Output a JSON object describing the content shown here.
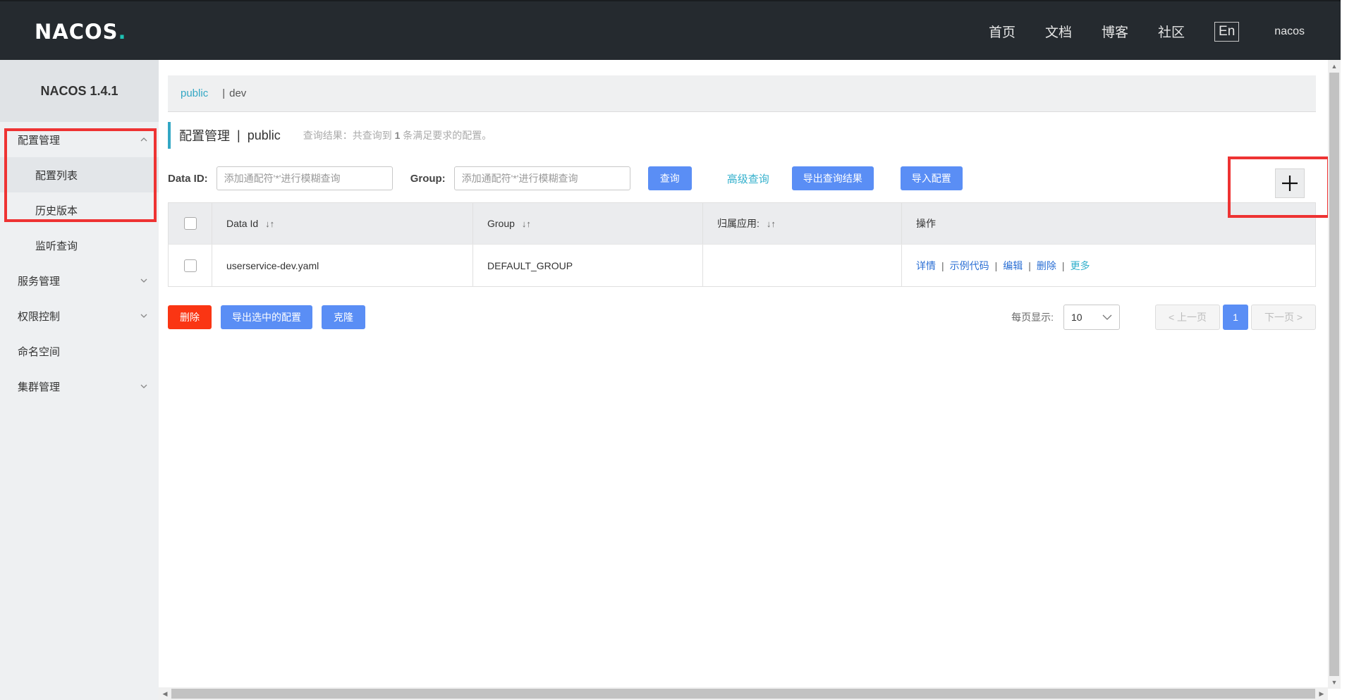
{
  "header": {
    "logo": "NACOS",
    "logo_dot": ".",
    "nav": [
      "首页",
      "文档",
      "博客",
      "社区"
    ],
    "lang": "En",
    "user": "nacos"
  },
  "sidebar": {
    "version": "NACOS 1.4.1",
    "items": [
      {
        "label": "配置管理",
        "expanded": true
      },
      {
        "label": "配置列表"
      },
      {
        "label": "历史版本"
      },
      {
        "label": "监听查询"
      },
      {
        "label": "服务管理"
      },
      {
        "label": "权限控制"
      },
      {
        "label": "命名空间"
      },
      {
        "label": "集群管理"
      }
    ]
  },
  "namespace": {
    "active": "public",
    "other": "dev",
    "separator": "|"
  },
  "page": {
    "title": "配置管理",
    "separator": "|",
    "namespace": "public",
    "result_prefix": "查询结果：共查询到",
    "result_count": "1",
    "result_suffix": "条满足要求的配置。"
  },
  "search": {
    "dataid_label": "Data ID:",
    "dataid_placeholder": "添加通配符'*'进行模糊查询",
    "group_label": "Group:",
    "group_placeholder": "添加通配符'*'进行模糊查询",
    "query_button": "查询",
    "advanced_link": "高级查询",
    "export_button": "导出查询结果",
    "import_button": "导入配置"
  },
  "table": {
    "columns": [
      "Data Id",
      "Group",
      "归属应用:",
      "操作"
    ],
    "sort_glyph": "↓↑",
    "rows": [
      {
        "data_id": "userservice-dev.yaml",
        "group": "DEFAULT_GROUP",
        "app": "",
        "ops": [
          "详情",
          "示例代码",
          "编辑",
          "删除",
          "更多"
        ]
      }
    ]
  },
  "bottom": {
    "delete_button": "删除",
    "export_selected_button": "导出选中的配置",
    "clone_button": "克隆",
    "page_size_label": "每页显示:",
    "page_size": "10",
    "prev": "上一页",
    "current_page": "1",
    "next": "下一页"
  },
  "colors": {
    "header_bg": "#252a2f",
    "primary": "#5a8ef5",
    "danger": "#fa3513",
    "accent": "#33a7c4",
    "highlight": "#ee3333"
  }
}
